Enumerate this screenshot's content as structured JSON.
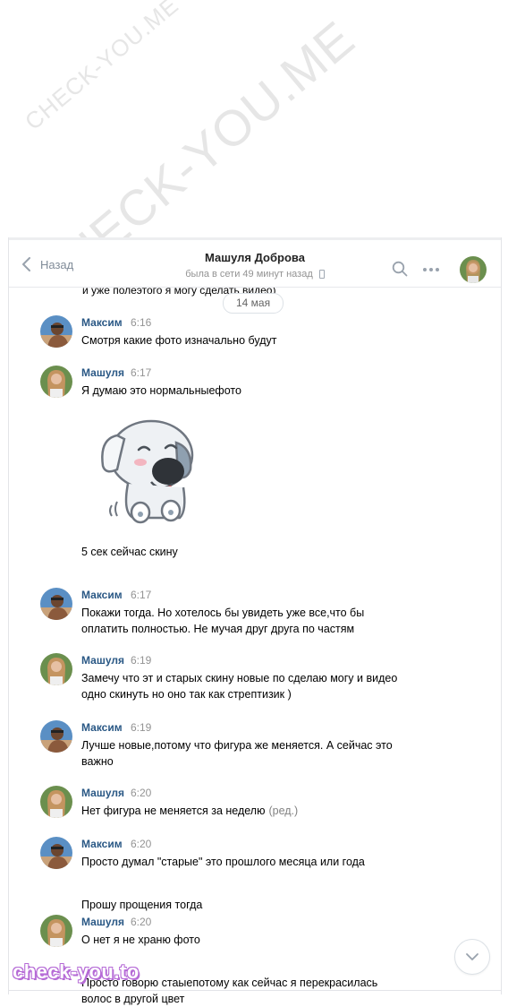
{
  "watermarks": {
    "small": "CHECK-YOU.ME",
    "large": "CHECK-YOU.ME",
    "logo": "check-you.to"
  },
  "header": {
    "back_label": "Назад",
    "title": "Машуля Доброва",
    "status": "была в сети 49 минут назад"
  },
  "chat": {
    "cut_text": "и уже полеэтого я могу сделать видео)",
    "date_label": "14 мая",
    "messages": [
      {
        "name": "Максим",
        "time": "6:16",
        "lines": [
          "Смотря какие фото изначально будут"
        ]
      },
      {
        "name": "Машуля",
        "time": "6:17",
        "lines": [
          "Я думаю это нормальныефото"
        ],
        "sticker": "dog-sticker",
        "after_sticker": "5 сек сейчас скину"
      },
      {
        "name": "Максим",
        "time": "6:17",
        "lines": [
          "Покажи тогда. Но хотелось бы увидеть уже все,что бы",
          "оплатить полностью. Не мучая друг друга по частям"
        ]
      },
      {
        "name": "Машуля",
        "time": "6:19",
        "lines": [
          "Замечу что эт и старых скину новые по сделаю могу и видео",
          "одно скинуть но оно так как стрептизик )"
        ]
      },
      {
        "name": "Максим",
        "time": "6:19",
        "lines": [
          "Лучше новые,потому что фигура же меняется. А сейчас это",
          "важно"
        ]
      },
      {
        "name": "Машуля",
        "time": "6:20",
        "lines": [
          "Нет фигура не меняется за неделю"
        ],
        "edited": "(ред.)"
      },
      {
        "name": "Максим",
        "time": "6:20",
        "lines": [
          "Просто думал \"старые\" это прошлого месяца или года"
        ],
        "extra": [
          "Прошу прощения тогда"
        ]
      },
      {
        "name": "Машуля",
        "time": "6:20",
        "lines": [
          "О нет я не храню фото"
        ],
        "extra": [
          "Просто говорю стаыепотому как сейчас я перекрасилась",
          "волос в другой цвет"
        ]
      }
    ]
  },
  "colors": {
    "link": "#2a5885",
    "muted": "#939393",
    "border": "#e3e4e8"
  }
}
